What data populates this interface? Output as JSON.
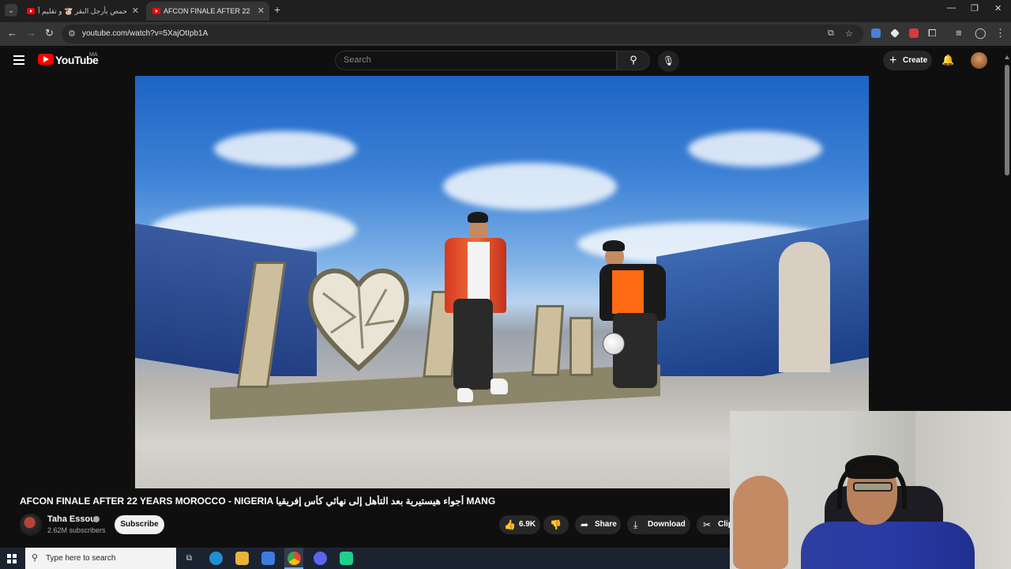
{
  "browser": {
    "tabs": [
      {
        "title": "الحمص بأرجل البقر 🐮 و تقليم أ...",
        "active": false
      },
      {
        "title": "AFCON FINALE AFTER 22 YEARS",
        "active": true
      }
    ],
    "url": "youtube.com/watch?v=5XajOtIpb1A"
  },
  "youtube": {
    "logo_text": "YouTube",
    "country": "MA",
    "search_placeholder": "Search",
    "create_label": "Create"
  },
  "video": {
    "title": "AFCON FINALE AFTER 22 YEARS MOROCCO - NIGERIA أجواء هيستيرية بعد التأهل إلى نهائي كأس إفريقيا MANG",
    "channel": "Taha Essou",
    "subscribers": "2.62M subscribers",
    "subscribe_label": "Subscribe",
    "likes": "6.9K",
    "share_label": "Share",
    "download_label": "Download",
    "clip_label": "Clip"
  },
  "taskbar": {
    "search_placeholder": "Type here to search"
  },
  "colors": {
    "background": "#0f0f0f",
    "accent_red": "#ff0000",
    "pill": "#272727"
  }
}
